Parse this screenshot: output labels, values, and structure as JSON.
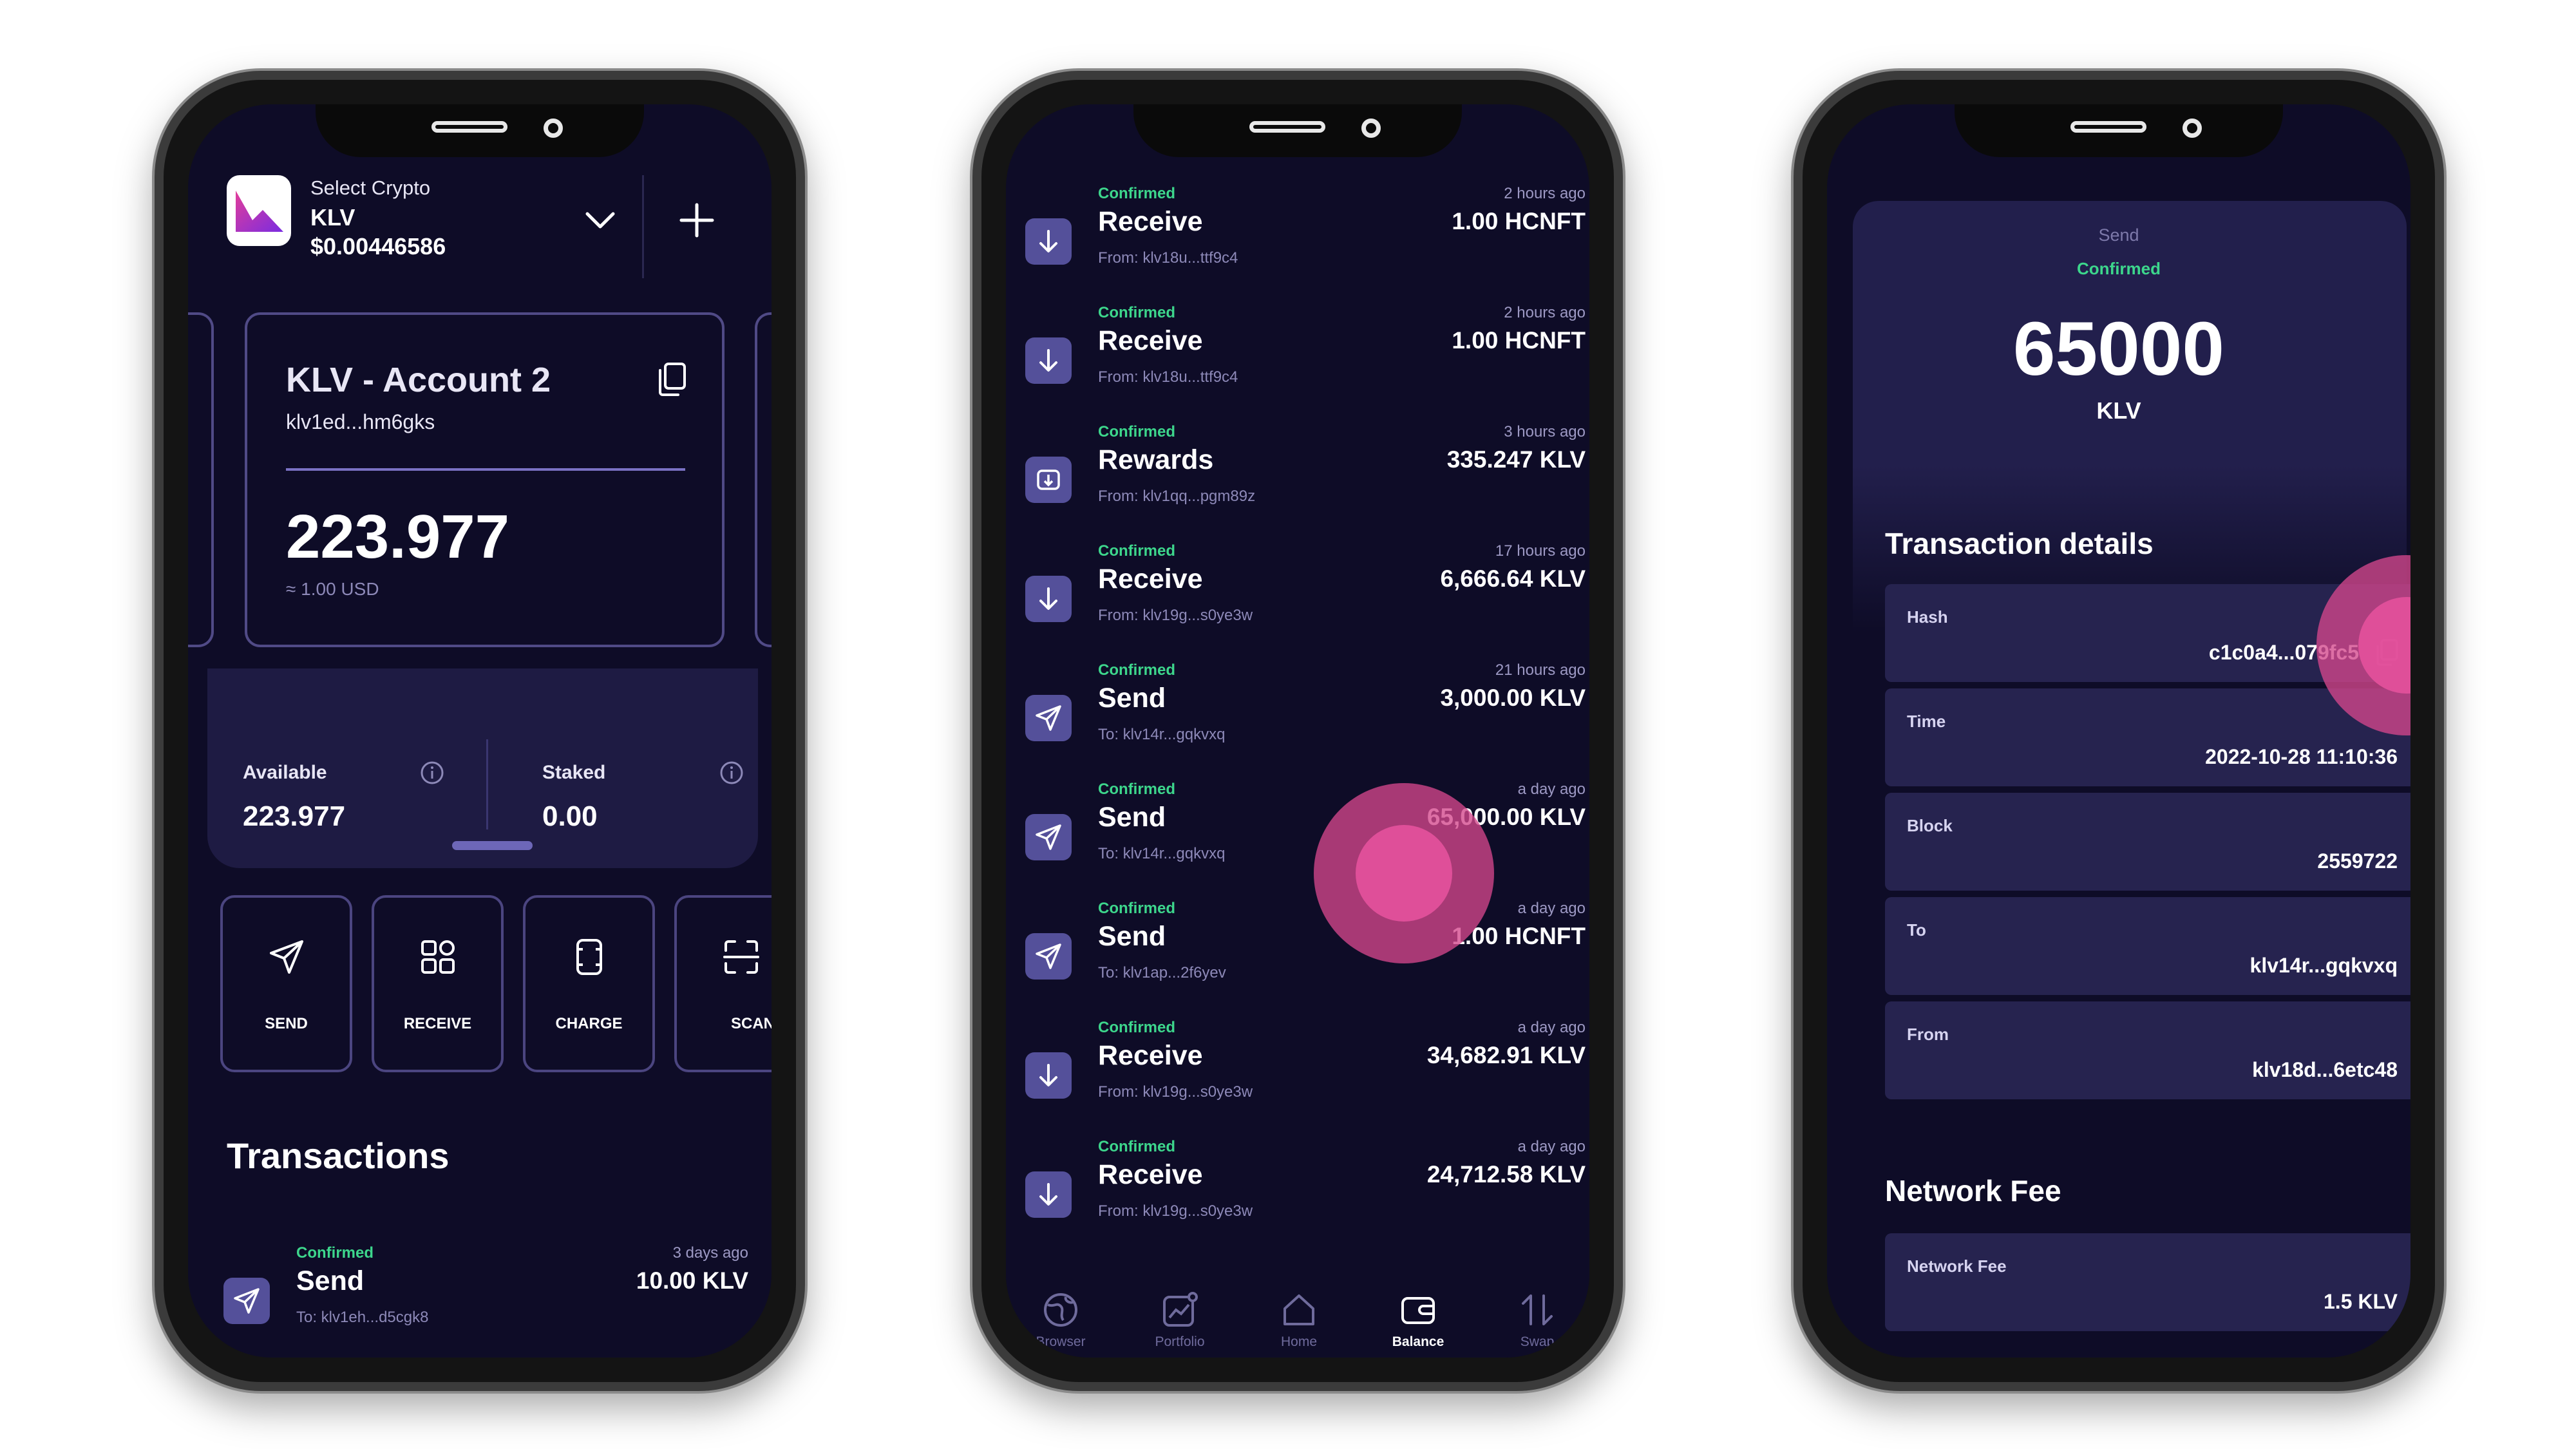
{
  "colors": {
    "background": "#0e0c27",
    "panel": "#1e1b43",
    "accent": "#504a86",
    "confirmed": "#3dd68c",
    "icon_bg": "#54509a",
    "touch": "#d4468c"
  },
  "phone1": {
    "header": {
      "select_label": "Select Crypto",
      "coin": "KLV",
      "price": "$0.00446586"
    },
    "account": {
      "name": "KLV - Account 2",
      "address": "klv1ed...hm6gks",
      "balance": "223.977",
      "usd": "≈ 1.00 USD"
    },
    "available": {
      "label": "Available",
      "value": "223.977"
    },
    "staked": {
      "label": "Staked",
      "value": "0.00"
    },
    "actions": [
      {
        "label": "SEND",
        "icon": "paper-plane-icon"
      },
      {
        "label": "RECEIVE",
        "icon": "qr-grid-icon"
      },
      {
        "label": "CHARGE",
        "icon": "charge-card-icon"
      },
      {
        "label": "SCAN",
        "icon": "scan-frame-icon"
      }
    ],
    "transactions_title": "Transactions",
    "transaction": {
      "status": "Confirmed",
      "type": "Send",
      "address": "To: klv1eh...d5cgk8",
      "time": "3 days ago",
      "amount": "10.00 KLV"
    }
  },
  "phone2": {
    "transactions": [
      {
        "status": "Confirmed",
        "type": "Receive",
        "address": "From: klv18u...ttf9c4",
        "time": "2 hours ago",
        "amount": "1.00 HCNFT",
        "icon": "arrow-down-icon"
      },
      {
        "status": "Confirmed",
        "type": "Receive",
        "address": "From: klv18u...ttf9c4",
        "time": "2 hours ago",
        "amount": "1.00 HCNFT",
        "icon": "arrow-down-icon"
      },
      {
        "status": "Confirmed",
        "type": "Rewards",
        "address": "From: klv1qq...pgm89z",
        "time": "3 hours ago",
        "amount": "335.247 KLV",
        "icon": "reward-icon"
      },
      {
        "status": "Confirmed",
        "type": "Receive",
        "address": "From: klv19g...s0ye3w",
        "time": "17 hours ago",
        "amount": "6,666.64 KLV",
        "icon": "arrow-down-icon"
      },
      {
        "status": "Confirmed",
        "type": "Send",
        "address": "To: klv14r...gqkvxq",
        "time": "21 hours ago",
        "amount": "3,000.00 KLV",
        "icon": "paper-plane-icon"
      },
      {
        "status": "Confirmed",
        "type": "Send",
        "address": "To: klv14r...gqkvxq",
        "time": "a day ago",
        "amount": "65,000.00 KLV",
        "icon": "paper-plane-icon"
      },
      {
        "status": "Confirmed",
        "type": "Send",
        "address": "To: klv1ap...2f6yev",
        "time": "a day ago",
        "amount": "1.00 HCNFT",
        "icon": "paper-plane-icon"
      },
      {
        "status": "Confirmed",
        "type": "Receive",
        "address": "From: klv19g...s0ye3w",
        "time": "a day ago",
        "amount": "34,682.91 KLV",
        "icon": "arrow-down-icon"
      },
      {
        "status": "Confirmed",
        "type": "Receive",
        "address": "From: klv19g...s0ye3w",
        "time": "a day ago",
        "amount": "24,712.58 KLV",
        "icon": "arrow-down-icon"
      }
    ],
    "nav": [
      {
        "label": "Browser",
        "icon": "globe-icon"
      },
      {
        "label": "Portfolio",
        "icon": "chart-icon"
      },
      {
        "label": "Home",
        "icon": "home-icon"
      },
      {
        "label": "Balance",
        "icon": "wallet-icon",
        "active": true
      },
      {
        "label": "Swap",
        "icon": "swap-arrows-icon"
      }
    ]
  },
  "phone3": {
    "type": "Send",
    "status": "Confirmed",
    "amount": "65000",
    "coin": "KLV",
    "details_title": "Transaction details",
    "details": [
      {
        "label": "Hash",
        "value": "c1c0a4...079fc5"
      },
      {
        "label": "Time",
        "value": "2022-10-28 11:10:36"
      },
      {
        "label": "Block",
        "value": "2559722"
      },
      {
        "label": "To",
        "value": "klv14r...gqkvxq"
      },
      {
        "label": "From",
        "value": "klv18d...6etc48"
      }
    ],
    "fee_title": "Network Fee",
    "fee": {
      "label": "Network Fee",
      "value": "1.5 KLV"
    }
  }
}
